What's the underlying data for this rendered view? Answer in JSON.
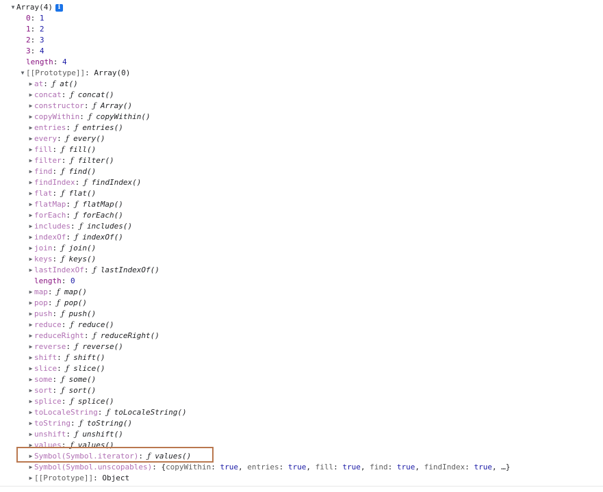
{
  "console": {
    "header": {
      "label": "Array(4)",
      "info_badge": "i"
    },
    "elements": [
      {
        "key": "0",
        "value": "1"
      },
      {
        "key": "1",
        "value": "2"
      },
      {
        "key": "2",
        "value": "3"
      },
      {
        "key": "3",
        "value": "4"
      }
    ],
    "length": {
      "key": "length",
      "value": "4"
    },
    "prototype": {
      "key": "[[Prototype]]",
      "value": "Array(0)"
    },
    "methods": [
      {
        "key": "at",
        "fn": "at()"
      },
      {
        "key": "concat",
        "fn": "concat()"
      },
      {
        "key": "constructor",
        "fn": "Array()"
      },
      {
        "key": "copyWithin",
        "fn": "copyWithin()"
      },
      {
        "key": "entries",
        "fn": "entries()"
      },
      {
        "key": "every",
        "fn": "every()"
      },
      {
        "key": "fill",
        "fn": "fill()"
      },
      {
        "key": "filter",
        "fn": "filter()"
      },
      {
        "key": "find",
        "fn": "find()"
      },
      {
        "key": "findIndex",
        "fn": "findIndex()"
      },
      {
        "key": "flat",
        "fn": "flat()"
      },
      {
        "key": "flatMap",
        "fn": "flatMap()"
      },
      {
        "key": "forEach",
        "fn": "forEach()"
      },
      {
        "key": "includes",
        "fn": "includes()"
      },
      {
        "key": "indexOf",
        "fn": "indexOf()"
      },
      {
        "key": "join",
        "fn": "join()"
      },
      {
        "key": "keys",
        "fn": "keys()"
      },
      {
        "key": "lastIndexOf",
        "fn": "lastIndexOf()"
      }
    ],
    "proto_length": {
      "key": "length",
      "value": "0"
    },
    "methods2": [
      {
        "key": "map",
        "fn": "map()"
      },
      {
        "key": "pop",
        "fn": "pop()"
      },
      {
        "key": "push",
        "fn": "push()"
      },
      {
        "key": "reduce",
        "fn": "reduce()"
      },
      {
        "key": "reduceRight",
        "fn": "reduceRight()"
      },
      {
        "key": "reverse",
        "fn": "reverse()"
      },
      {
        "key": "shift",
        "fn": "shift()"
      },
      {
        "key": "slice",
        "fn": "slice()"
      },
      {
        "key": "some",
        "fn": "some()"
      },
      {
        "key": "sort",
        "fn": "sort()"
      },
      {
        "key": "splice",
        "fn": "splice()"
      },
      {
        "key": "toLocaleString",
        "fn": "toLocaleString()"
      },
      {
        "key": "toString",
        "fn": "toString()"
      },
      {
        "key": "unshift",
        "fn": "unshift()"
      },
      {
        "key": "values",
        "fn": "values()"
      }
    ],
    "symbol_iterator": {
      "key": "Symbol(Symbol.iterator)",
      "fn": "values()"
    },
    "symbol_unscopables": {
      "key": "Symbol(Symbol.unscopables)",
      "pairs": [
        {
          "k": "copyWithin",
          "v": "true"
        },
        {
          "k": "entries",
          "v": "true"
        },
        {
          "k": "fill",
          "v": "true"
        },
        {
          "k": "find",
          "v": "true"
        },
        {
          "k": "findIndex",
          "v": "true"
        }
      ],
      "ellipsis": "…"
    },
    "inner_prototype": {
      "key": "[[Prototype]]",
      "value": "Object"
    },
    "f_glyph": "ƒ",
    "colon": ":",
    "expanded_glyph": "▼",
    "collapsed_glyph": "▶"
  }
}
